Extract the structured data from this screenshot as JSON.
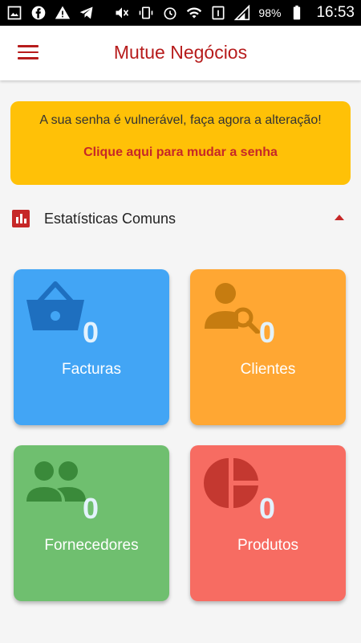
{
  "statusbar": {
    "battery": "98%",
    "time": "16:53"
  },
  "appbar": {
    "title": "Mutue Negócios"
  },
  "alert": {
    "message": "A sua senha é vulnerável, faça agora a alteração!",
    "link": "Clique aqui para mudar a senha"
  },
  "section": {
    "title": "Estatísticas Comuns"
  },
  "cards": [
    {
      "count": "0",
      "label": "Facturas",
      "color": "#42a5f5",
      "icon": "basket-icon"
    },
    {
      "count": "0",
      "label": "Clientes",
      "color": "#ffa733",
      "icon": "person-search-icon"
    },
    {
      "count": "0",
      "label": "Fornecedores",
      "color": "#6fbf6f",
      "icon": "people-icon"
    },
    {
      "count": "0",
      "label": "Produtos",
      "color": "#f76c62",
      "icon": "pie-chart-icon"
    }
  ],
  "colors": {
    "accent": "#b71c1c",
    "alert_bg": "#ffc107",
    "link": "#c62828"
  }
}
